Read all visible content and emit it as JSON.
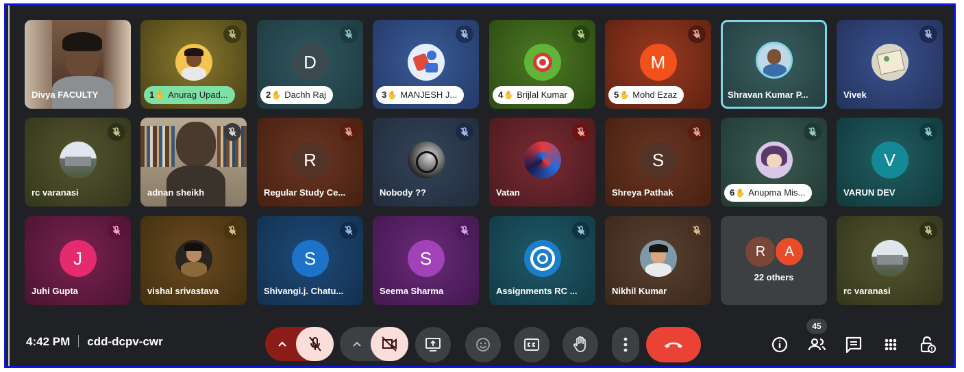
{
  "meeting": {
    "time": "4:42 PM",
    "code": "cdd-dcpv-cwr"
  },
  "tiles": [
    {
      "name": "Divya FACULTY",
      "kind": "video"
    },
    {
      "name": "Anurag Upad...",
      "hand": "1",
      "pill": "green",
      "kind": "photo",
      "muted": true
    },
    {
      "name": "Dachh Raj",
      "hand": "2",
      "pill": "white",
      "letter": "D",
      "muted": true
    },
    {
      "name": "MANJESH J...",
      "hand": "3",
      "pill": "white",
      "kind": "photo",
      "muted": true
    },
    {
      "name": "Brijlal Kumar",
      "hand": "4",
      "pill": "white",
      "kind": "photo",
      "muted": true
    },
    {
      "name": "Mohd Ezaz",
      "hand": "5",
      "pill": "white",
      "letter": "M",
      "muted": true
    },
    {
      "name": "Shravan Kumar P...",
      "kind": "photo",
      "active": true
    },
    {
      "name": "Vivek",
      "kind": "photo",
      "muted": true
    },
    {
      "name": "rc varanasi",
      "kind": "photo",
      "muted": true
    },
    {
      "name": "adnan sheikh",
      "kind": "video",
      "muted": true
    },
    {
      "name": "Regular Study Ce...",
      "letter": "R",
      "muted": true
    },
    {
      "name": "Nobody ??",
      "kind": "photo",
      "muted": true
    },
    {
      "name": "Vatan",
      "kind": "photo",
      "muted": true
    },
    {
      "name": "Shreya Pathak",
      "letter": "S",
      "muted": true
    },
    {
      "name": "Anupma Mis...",
      "hand": "6",
      "pill": "white",
      "kind": "photo",
      "muted": true
    },
    {
      "name": "VARUN DEV",
      "letter": "V",
      "muted": true
    },
    {
      "name": "Juhi Gupta",
      "letter": "J",
      "muted": true
    },
    {
      "name": "vishal srivastava",
      "kind": "photo",
      "muted": true
    },
    {
      "name": "Shivangi.j. Chatu...",
      "letter": "S",
      "muted": true
    },
    {
      "name": "Seema Sharma",
      "letter": "S",
      "muted": true
    },
    {
      "name": "Assignments RC ...",
      "kind": "photo",
      "muted": true
    },
    {
      "name": "Nikhil Kumar",
      "kind": "photo",
      "muted": true
    },
    {
      "name": "22 others",
      "others": [
        "R",
        "A"
      ]
    },
    {
      "name": "rc varanasi",
      "kind": "photo",
      "muted": true
    }
  ],
  "hand_glyph": "✋",
  "participants_count": "45",
  "icons": {
    "mic": "mic-off-icon",
    "camera": "camera-off-icon",
    "present": "present-screen-icon",
    "emoji": "emoji-icon",
    "captions": "captions-icon",
    "hand": "raise-hand-icon",
    "more": "more-options-icon",
    "end": "end-call-icon",
    "info": "info-icon",
    "people": "people-icon",
    "chat": "chat-icon",
    "activities": "activities-icon",
    "lock": "host-controls-icon"
  },
  "colors": {
    "end_call": "#ea4335",
    "frame_border": "#1014e0",
    "background": "#202124"
  }
}
